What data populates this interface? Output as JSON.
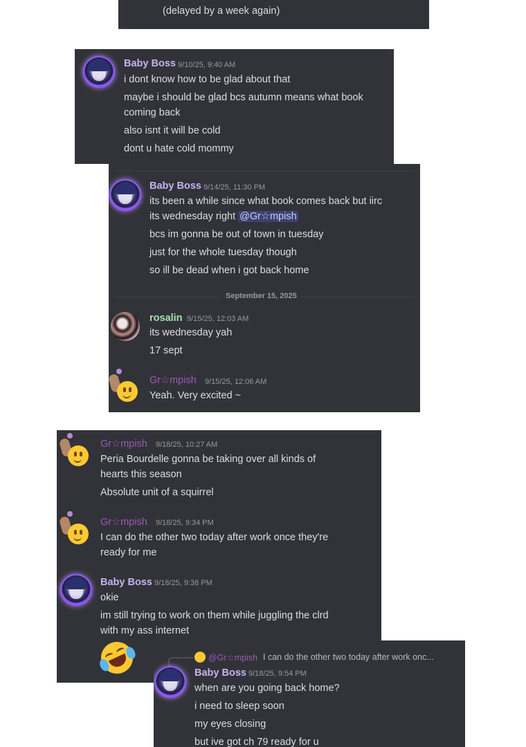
{
  "panel0": {
    "lines": [
      "(delayed by a week again)"
    ]
  },
  "panel1": {
    "author": "Baby Boss",
    "timestamp": "9/10/25, 9:40 AM",
    "lines": [
      "i dont know how to be glad about that",
      "maybe i should be glad bcs autumn means what book",
      "coming back",
      "also isnt it will be cold",
      "dont u hate cold mommy"
    ]
  },
  "panel2": {
    "msg1": {
      "author": "Baby Boss",
      "timestamp": "9/14/25, 11:30 PM",
      "line1": "its been a while since what book comes back but iirc",
      "line2_prefix": "its wednesday right",
      "mention": "@Gr☆mpish",
      "lines": [
        "bcs im gonna be out of town in tuesday",
        "just for the whole tuesday though",
        "so ill be dead when i got back home"
      ]
    },
    "divider": "September 15, 2025",
    "msg2": {
      "author": "rosalin",
      "timestamp": "9/15/25, 12:03 AM",
      "lines": [
        "its wednesday yah",
        "17 sept"
      ]
    },
    "msg3": {
      "author": "Gr☆mpish",
      "timestamp": "9/15/25, 12:06 AM",
      "lines": [
        "Yeah. Very excited ~"
      ]
    }
  },
  "panel3": {
    "msg1": {
      "author": "Gr☆mpish",
      "timestamp": "9/18/25, 10:27 AM",
      "lines": [
        "Peria Bourdelle gonna be taking over all kinds of",
        "hearts this season",
        "Absolute unit of a squirrel"
      ]
    },
    "msg2": {
      "author": "Gr☆mpish",
      "timestamp": "9/18/25, 9:34 PM",
      "lines": [
        "I can do the other two today after work once they're",
        "ready for me"
      ]
    },
    "msg3": {
      "author": "Baby Boss",
      "timestamp": "9/18/25, 9:38 PM",
      "lines": [
        "okie",
        "im still trying to work on them while juggling the clrd",
        "with my ass internet"
      ],
      "emoji": "rolling-on-floor-laughing-emoji"
    }
  },
  "panel4": {
    "reply": {
      "author": "@Gr☆mpish",
      "preview": "I can do the other two today after work onc..."
    },
    "author": "Baby Boss",
    "timestamp": "9/18/25, 9:54 PM",
    "lines": [
      "when are you going back home?",
      "i need to sleep soon",
      "my eyes closing",
      "but ive got ch 79 ready for u"
    ]
  }
}
